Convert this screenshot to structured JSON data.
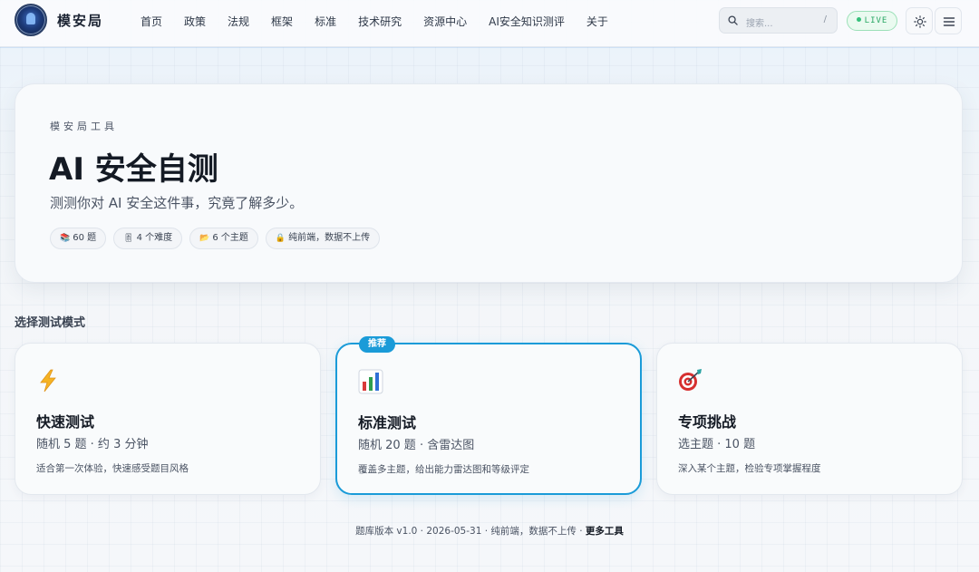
{
  "header": {
    "brand": "模安局",
    "nav": [
      "首页",
      "政策",
      "法规",
      "框架",
      "标准",
      "技术研究",
      "资源中心",
      "AI安全知识测评",
      "关于"
    ],
    "search_placeholder": "搜索...",
    "search_shortcut": "/",
    "live_label": "LIVE"
  },
  "hero": {
    "eyebrow": "模安局工具",
    "title": "AI 安全自测",
    "subtitle": "测测你对 AI 安全这件事，究竟了解多少。",
    "chips": [
      {
        "icon": "📚",
        "icon_name": "books-icon",
        "label": "60 题"
      },
      {
        "icon": "🎚",
        "icon_name": "level-slider-icon",
        "label": "4 个难度"
      },
      {
        "icon": "📂",
        "icon_name": "folder-icon",
        "label": "6 个主题"
      },
      {
        "icon": "🔒",
        "icon_name": "lock-icon",
        "label": "纯前端，数据不上传"
      }
    ]
  },
  "modes": {
    "section_title": "选择测试模式",
    "cards": [
      {
        "icon_name": "lightning-icon",
        "title": "快速测试",
        "meta": "随机 5 题 · 约 3 分钟",
        "desc": "适合第一次体验，快速感受题目风格",
        "badge": ""
      },
      {
        "icon_name": "bar-chart-icon",
        "title": "标准测试",
        "meta": "随机 20 题 · 含雷达图",
        "desc": "覆盖多主题，给出能力雷达图和等级评定",
        "badge": "推荐"
      },
      {
        "icon_name": "target-icon",
        "title": "专项挑战",
        "meta": "选主题 · 10 题",
        "desc": "深入某个主题，检验专项掌握程度",
        "badge": ""
      }
    ]
  },
  "footer": {
    "text": "题库版本 v1.0 · 2026-05-31 · 纯前端，数据不上传 · ",
    "more_link": "更多工具"
  },
  "colors": {
    "accent": "#1a9bd8",
    "live_green": "#2aa765",
    "text_primary": "#141a24"
  }
}
